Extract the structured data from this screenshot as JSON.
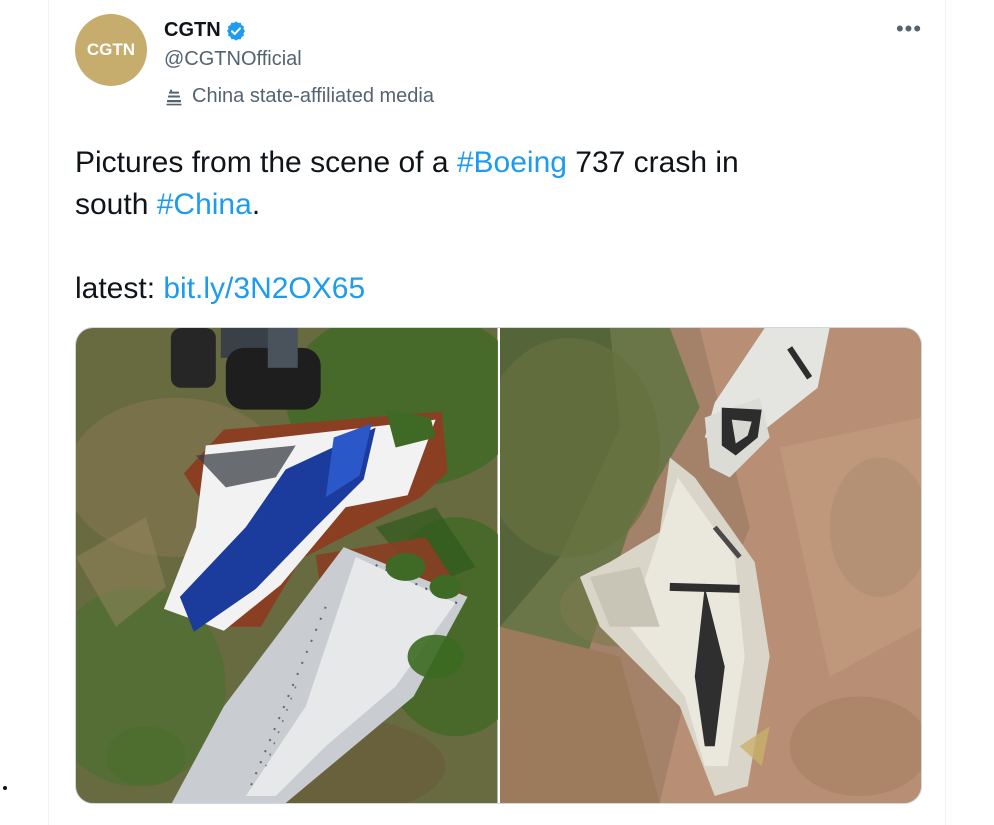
{
  "author": {
    "avatar_text": "CGTN",
    "display_name": "CGTN",
    "handle": "@CGTNOfficial",
    "label": "China state-affiliated media",
    "avatar_color": "#c6ad6e",
    "verified_color": "#1d9bf0"
  },
  "tweet": {
    "line1_before": "Pictures from the scene of a ",
    "hashtag_boeing": "#Boeing",
    "line1_after": " 737 crash in",
    "line2_before": "south ",
    "hashtag_china": "#China",
    "line2_after": ".",
    "latest_label": "latest: ",
    "link_text": "bit.ly/3N2OX65",
    "link_color": "#1d9bf0"
  },
  "icons": {
    "more": "more-horizontal-icon",
    "verified": "verified-badge-icon",
    "affiliation": "state-media-icon"
  },
  "media": {
    "count": 2,
    "photos": [
      "crash-debris-photo-1",
      "crash-debris-photo-2"
    ]
  }
}
